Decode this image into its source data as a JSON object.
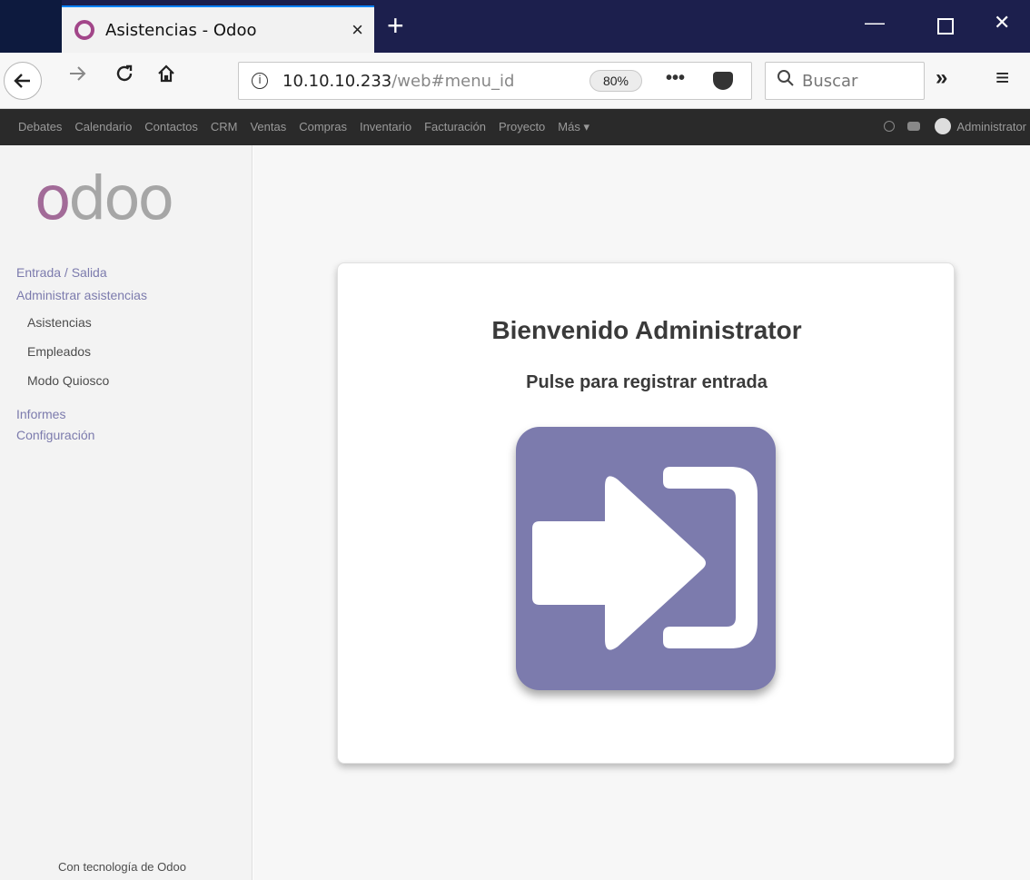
{
  "browser": {
    "tab_title": "Asistencias - Odoo",
    "tab_close": "×",
    "new_tab": "+",
    "window_min": "—",
    "window_close": "✕",
    "url_main": "10.10.10.233",
    "url_rest": "/web#menu_id",
    "zoom": "80%",
    "page_actions": "•••",
    "search_placeholder": "Buscar",
    "overflow": "»",
    "menu": "≡",
    "info": "i"
  },
  "odoo_menu": {
    "items": [
      "Debates",
      "Calendario",
      "Contactos",
      "CRM",
      "Ventas",
      "Compras",
      "Inventario",
      "Facturación",
      "Proyecto",
      "Más ▾"
    ],
    "user": "Administrator"
  },
  "sidebar": {
    "logo_first": "o",
    "logo_rest": "doo",
    "section_checkin": "Entrada / Salida",
    "section_manage": "Administrar asistencias",
    "item_attendances": "Asistencias",
    "item_employees": "Empleados",
    "item_kiosk": "Modo Quiosco",
    "section_reports": "Informes",
    "section_config": "Configuración",
    "powered": "Con tecnología de Odoo"
  },
  "main": {
    "welcome": "Bienvenido Administrator",
    "prompt": "Pulse para registrar entrada"
  },
  "colors": {
    "odoo_purple": "#7c7bad",
    "topbar": "#2a2a2a",
    "sidebar_bg": "#f3f3f3"
  },
  "icons": {
    "checkin": "sign-in-icon"
  }
}
